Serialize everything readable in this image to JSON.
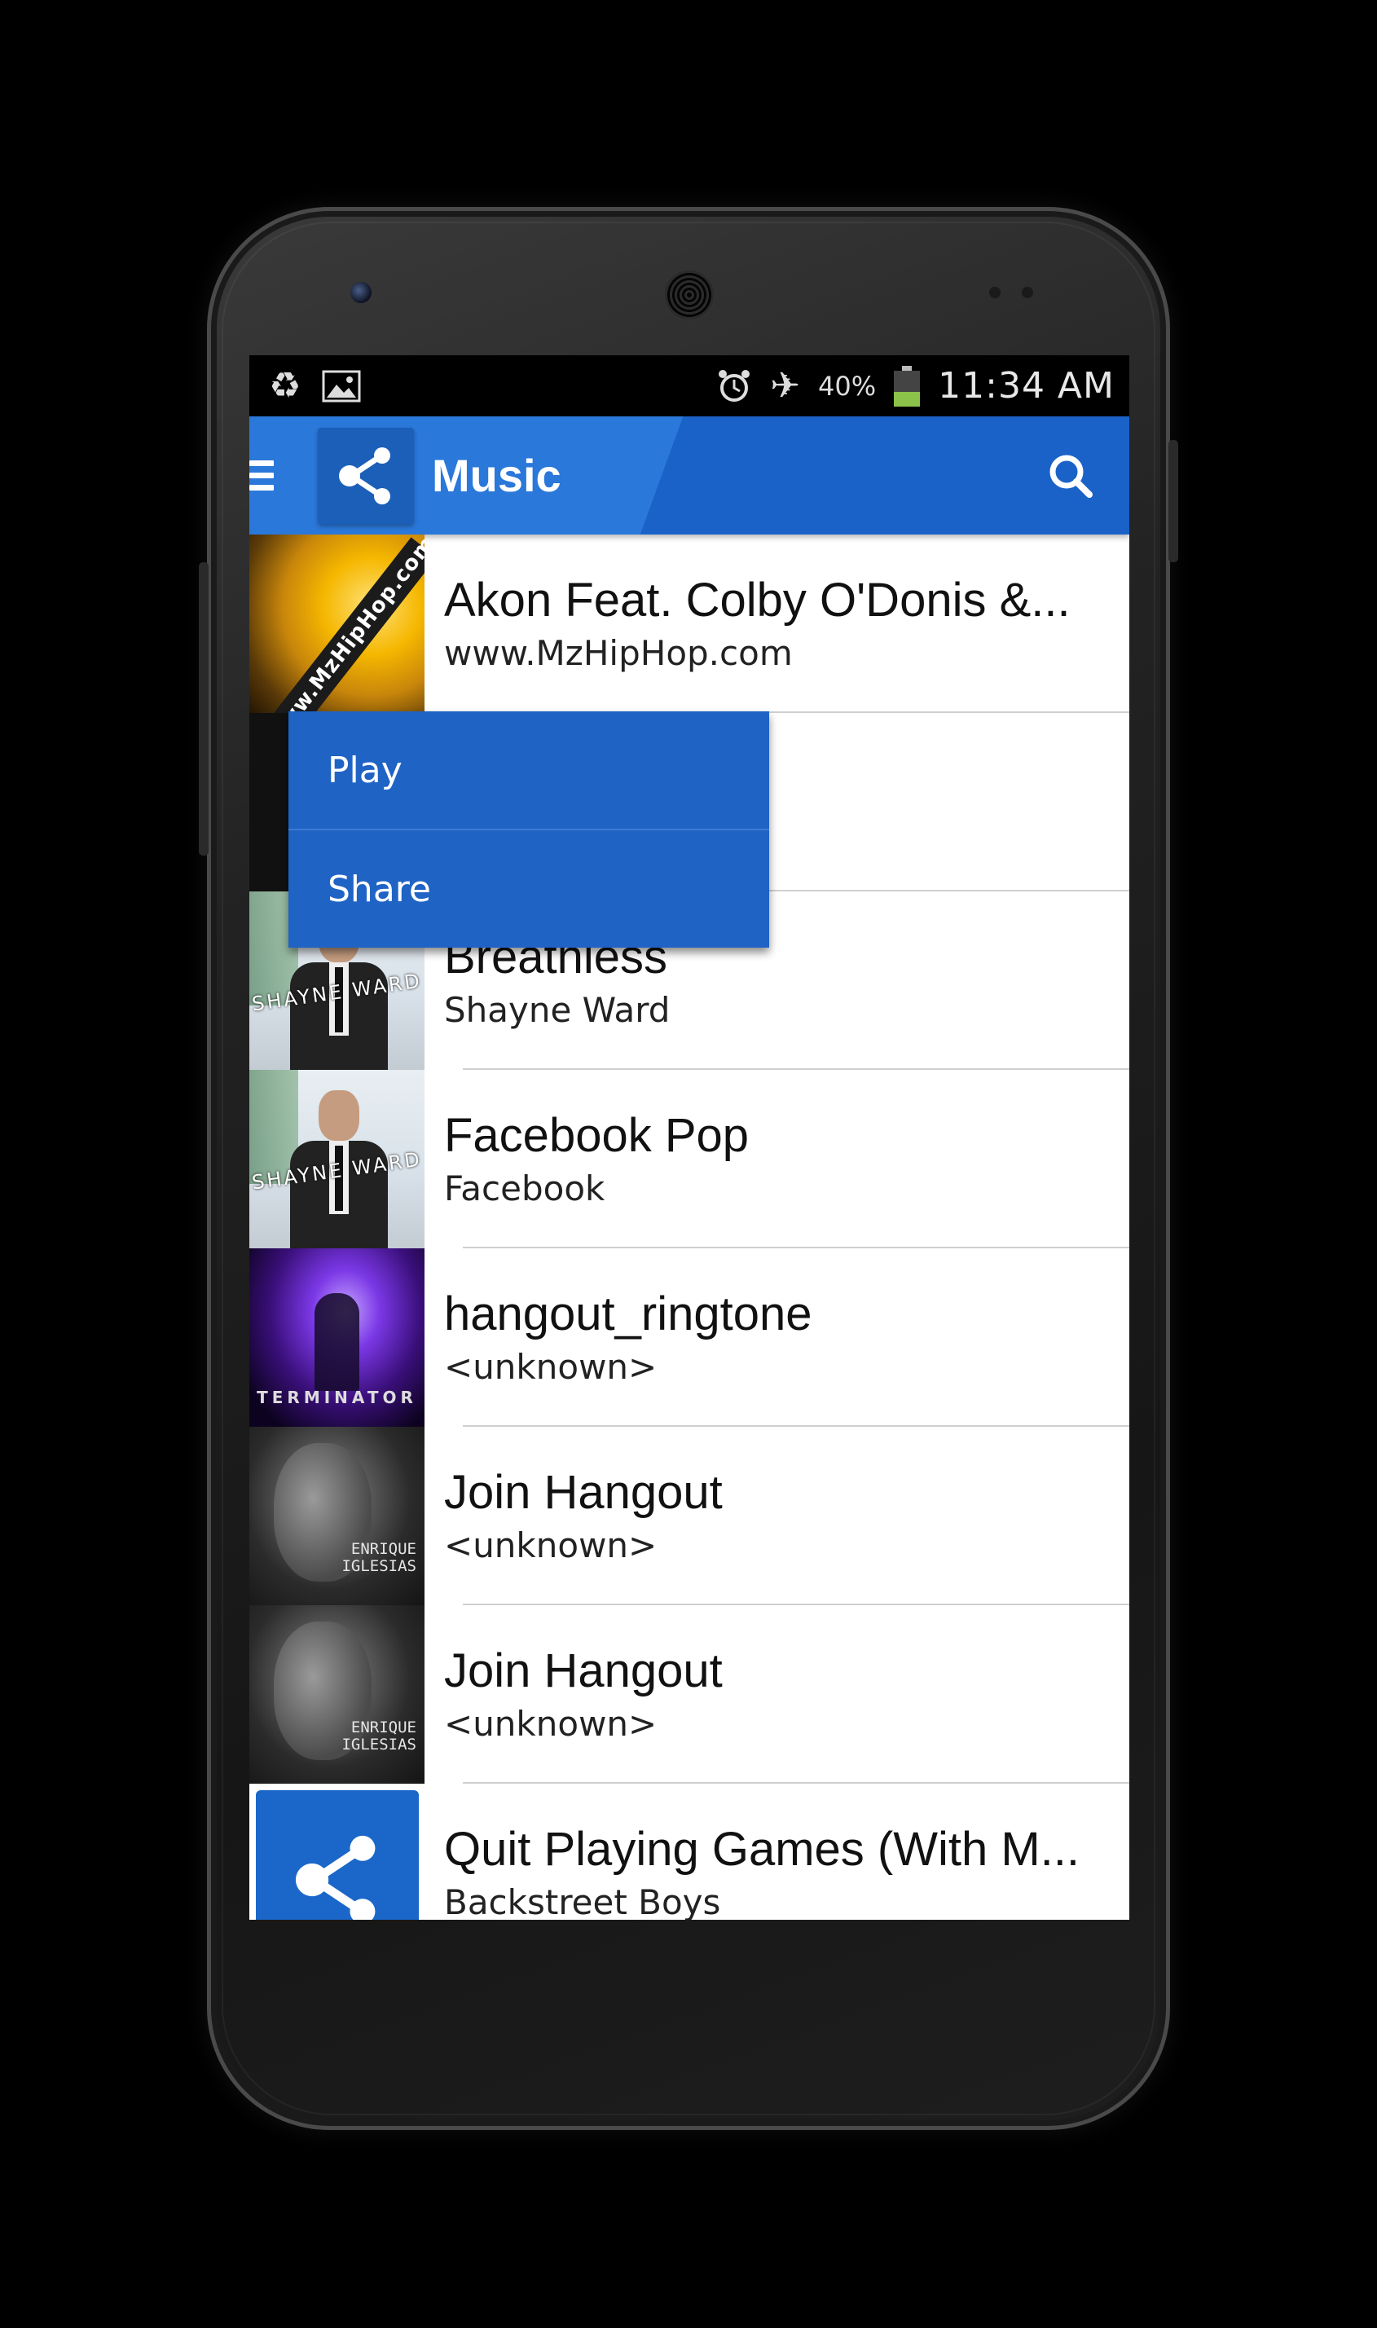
{
  "status_bar": {
    "left_icons": [
      "recycle-icon",
      "image-icon"
    ],
    "right_icons": [
      "alarm-icon",
      "airplane-icon"
    ],
    "battery_percent": "40%",
    "battery_level": 0.4,
    "time": "11:34 AM"
  },
  "app_bar": {
    "title": "Music",
    "menu_icon": "hamburger-menu-icon",
    "logo_icon": "share-icon",
    "search_icon": "search-icon",
    "color": "#2a78da"
  },
  "songs": [
    {
      "title": "Akon Feat. Colby O'Donis &...",
      "artist": "www.MzHipHop.com",
      "thumb_text": "www.MzHipHop.com"
    },
    {
      "title": "",
      "artist": ""
    },
    {
      "title": "Breathless",
      "artist": "Shayne Ward",
      "thumb_text": "SHAYNE WARD"
    },
    {
      "title": "Facebook Pop",
      "artist": "Facebook",
      "thumb_text": "SHAYNE WARD"
    },
    {
      "title": "hangout_ringtone",
      "artist": "<unknown>",
      "thumb_text": "TERMINATOR"
    },
    {
      "title": "Join Hangout",
      "artist": "<unknown>",
      "thumb_text": "ENRIQUE IGLESIAS"
    },
    {
      "title": "Join Hangout",
      "artist": "<unknown>",
      "thumb_text": "ENRIQUE IGLESIAS"
    },
    {
      "title": "Quit Playing Games (With M...",
      "artist": "Backstreet Boys"
    }
  ],
  "context_menu": {
    "items": [
      {
        "label": "Play"
      },
      {
        "label": "Share"
      }
    ]
  }
}
